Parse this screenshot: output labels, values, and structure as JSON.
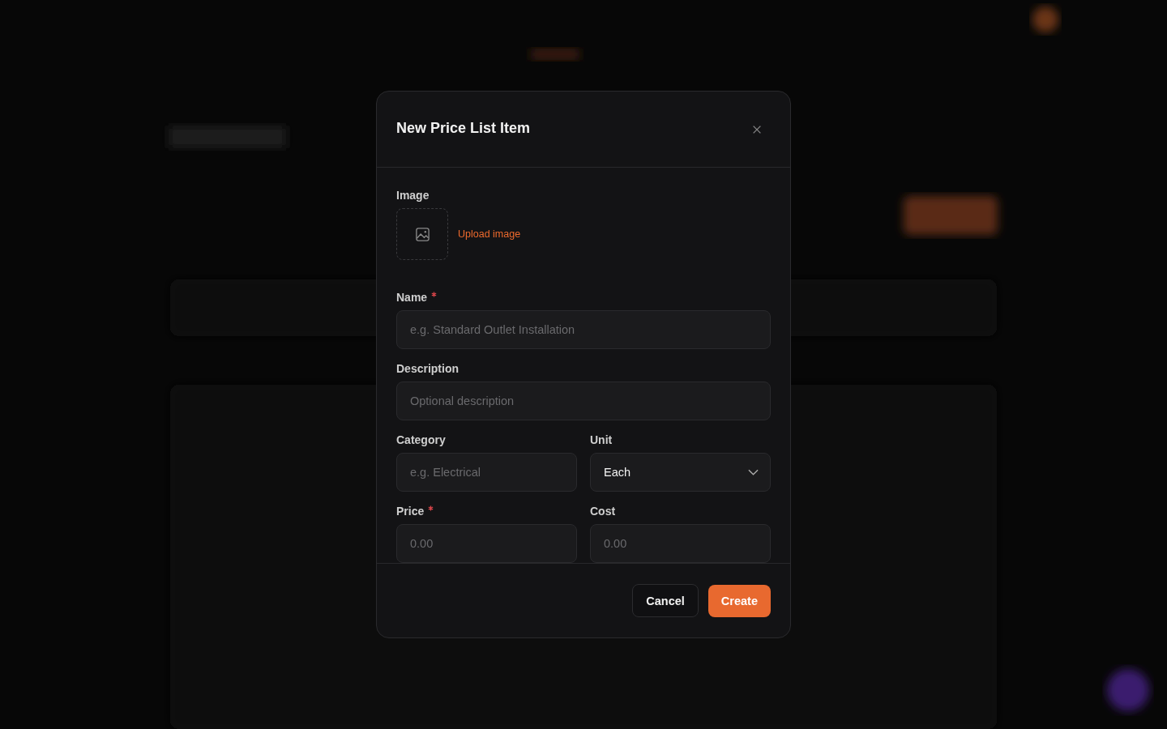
{
  "modal": {
    "title": "New Price List Item",
    "image": {
      "label": "Image",
      "link": "Upload image"
    },
    "rows": [
      {
        "fields": [
          {
            "kind": "text",
            "label": "Name",
            "required": true,
            "placeholder": "e.g. Standard Outlet Installation"
          }
        ]
      },
      {
        "fields": [
          {
            "kind": "text",
            "label": "Description",
            "required": false,
            "placeholder": "Optional description"
          }
        ]
      },
      {
        "fields": [
          {
            "kind": "text",
            "label": "Category",
            "required": false,
            "placeholder": "e.g. Electrical"
          },
          {
            "kind": "select",
            "label": "Unit",
            "required": false,
            "value": "Each"
          }
        ]
      },
      {
        "fields": [
          {
            "kind": "text",
            "label": "Price",
            "required": true,
            "placeholder": "0.00"
          },
          {
            "kind": "text",
            "label": "Cost",
            "required": false,
            "placeholder": "0.00"
          }
        ]
      }
    ],
    "buttons": [
      {
        "kind": "secondary",
        "label": "Cancel"
      },
      {
        "kind": "primary",
        "label": "Create"
      }
    ]
  }
}
